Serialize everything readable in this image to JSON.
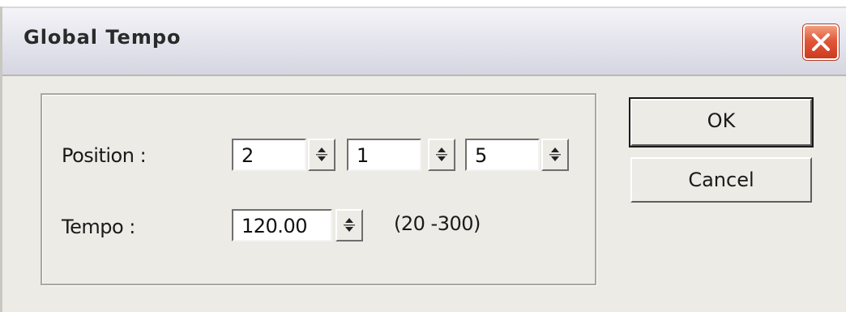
{
  "window": {
    "title": "Global Tempo"
  },
  "position": {
    "label": "Position :",
    "bar": "2",
    "beat": "1",
    "tick": "5"
  },
  "tempo": {
    "label": "Tempo :",
    "value": "120.00",
    "range": "(20 -300)"
  },
  "buttons": {
    "ok": "OK",
    "cancel": "Cancel"
  },
  "icons": {
    "close": "close-x-icon",
    "spin_up": "triangle-up-icon",
    "spin_down": "triangle-down-icon"
  },
  "colors": {
    "close_button": "#e2583a",
    "dialog_background": "#ecebe5"
  }
}
